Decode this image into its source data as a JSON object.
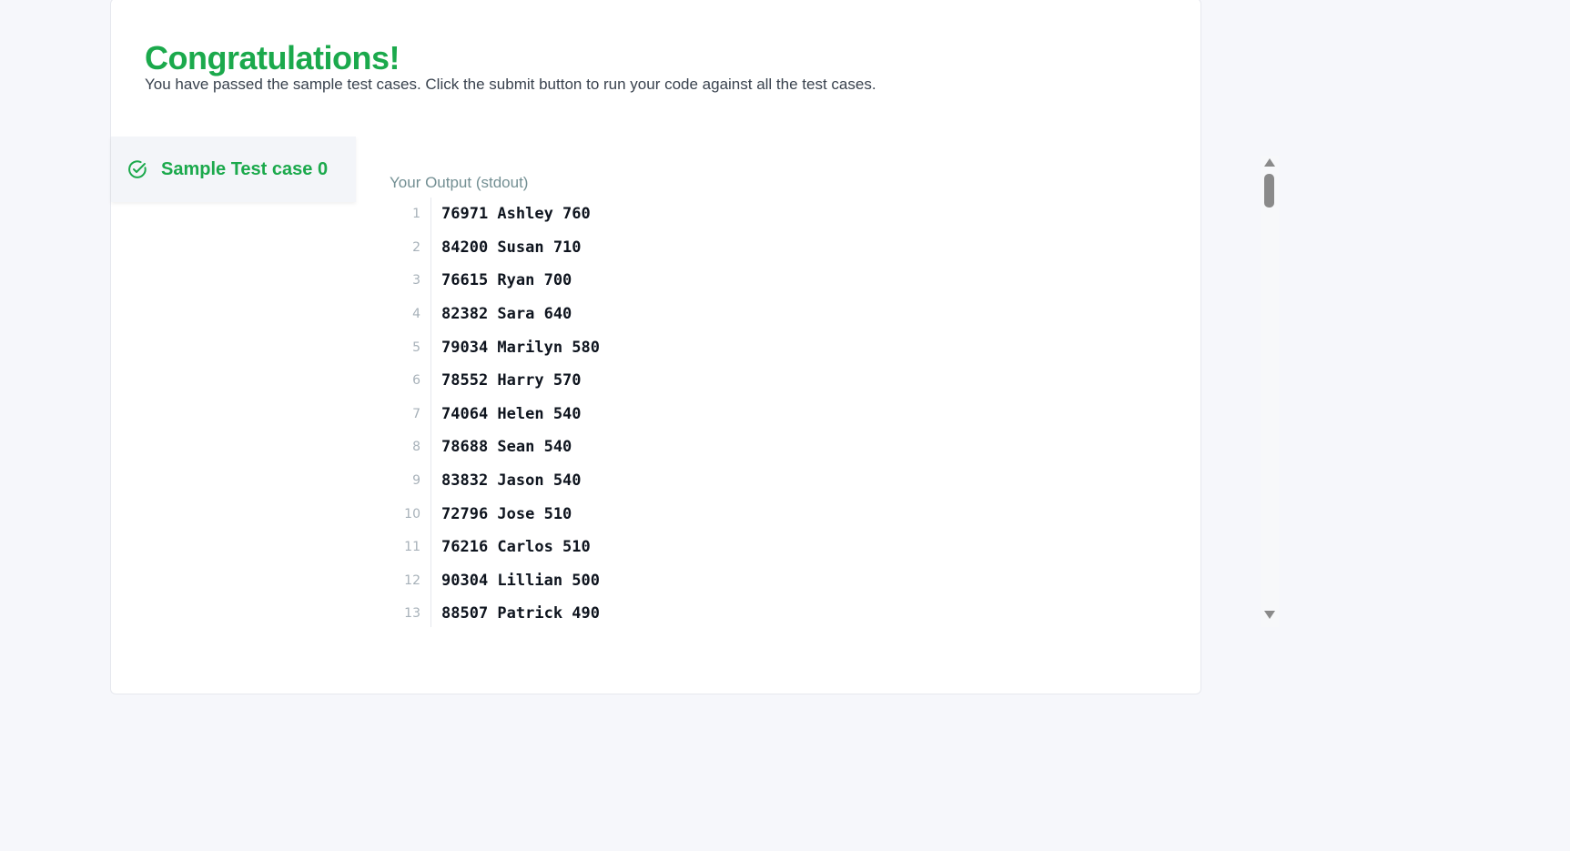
{
  "result": {
    "title": "Congratulations!",
    "message": "You have passed the sample test cases. Click the submit button to run your code against all the test cases."
  },
  "tabs": [
    {
      "label": "Sample Test case 0",
      "icon": "check-circle-icon",
      "status": "passed"
    }
  ],
  "output": {
    "label": "Your Output (stdout)",
    "lines": [
      {
        "n": "1",
        "text": "76971 Ashley 760"
      },
      {
        "n": "2",
        "text": "84200 Susan 710"
      },
      {
        "n": "3",
        "text": "76615 Ryan 700"
      },
      {
        "n": "4",
        "text": "82382 Sara 640"
      },
      {
        "n": "5",
        "text": "79034 Marilyn 580"
      },
      {
        "n": "6",
        "text": "78552 Harry 570"
      },
      {
        "n": "7",
        "text": "74064 Helen 540"
      },
      {
        "n": "8",
        "text": "78688 Sean 540"
      },
      {
        "n": "9",
        "text": "83832 Jason 540"
      },
      {
        "n": "10",
        "text": "72796 Jose 510"
      },
      {
        "n": "11",
        "text": "76216 Carlos 510"
      },
      {
        "n": "12",
        "text": "90304 Lillian 500"
      },
      {
        "n": "13",
        "text": "88507 Patrick 490"
      }
    ]
  },
  "colors": {
    "success": "#1ba94c",
    "background": "#f6f7fb"
  }
}
